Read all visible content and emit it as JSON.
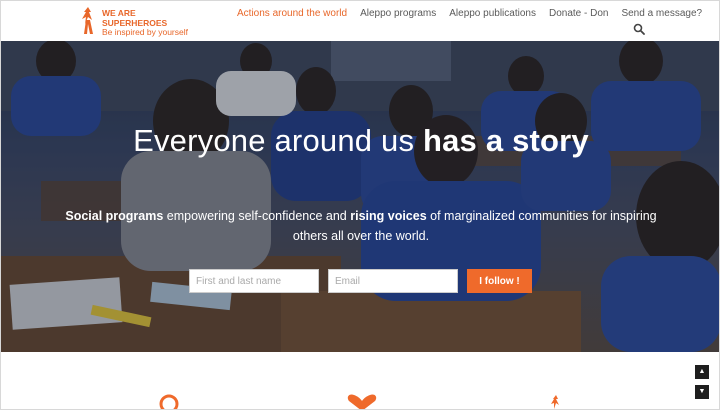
{
  "brand": {
    "line1": "WE ARE",
    "line2": "SUPERHEROES",
    "line3": "Be inspired by yourself",
    "accent": "#e8672a"
  },
  "nav": {
    "items": [
      {
        "label": "Actions around the world",
        "active": true
      },
      {
        "label": "Aleppo programs",
        "active": false
      },
      {
        "label": "Aleppo publications",
        "active": false
      },
      {
        "label": "Donate - Don",
        "active": false
      },
      {
        "label": "Send a message?",
        "active": false
      }
    ],
    "search_icon": "search-icon"
  },
  "hero": {
    "title_light": "Everyone around us ",
    "title_bold": "has a story",
    "sub_bold1": "Social programs",
    "sub_text1": " empowering self-confidence and ",
    "sub_bold2": "rising voices",
    "sub_text2": " of marginalized communities for inspiring others all over the world.",
    "name_placeholder": "First and last name",
    "email_placeholder": "Email",
    "button_label": "I follow !",
    "button_color": "#ef6a2b"
  },
  "scroll": {
    "up_icon": "caret-up-icon",
    "down_icon": "caret-down-icon",
    "up_glyph": "▲",
    "down_glyph": "▼"
  }
}
